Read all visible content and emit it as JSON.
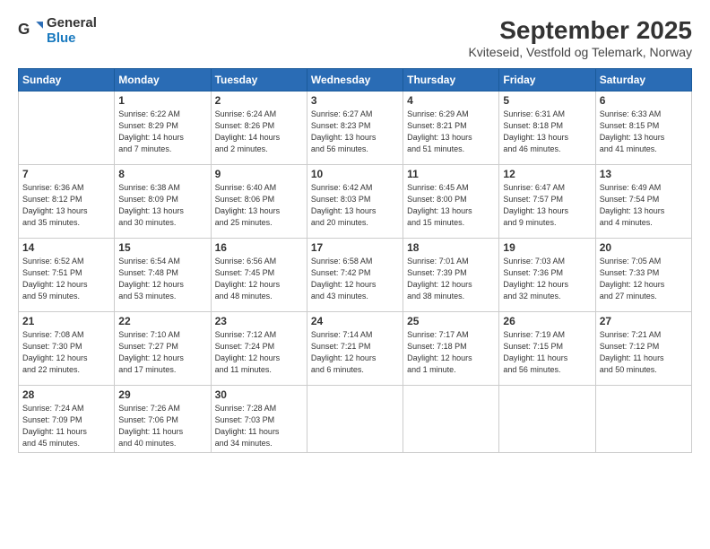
{
  "header": {
    "logo_general": "General",
    "logo_blue": "Blue",
    "month_title": "September 2025",
    "subtitle": "Kviteseid, Vestfold og Telemark, Norway"
  },
  "days_of_week": [
    "Sunday",
    "Monday",
    "Tuesday",
    "Wednesday",
    "Thursday",
    "Friday",
    "Saturday"
  ],
  "weeks": [
    [
      {
        "day": "",
        "info": ""
      },
      {
        "day": "1",
        "info": "Sunrise: 6:22 AM\nSunset: 8:29 PM\nDaylight: 14 hours\nand 7 minutes."
      },
      {
        "day": "2",
        "info": "Sunrise: 6:24 AM\nSunset: 8:26 PM\nDaylight: 14 hours\nand 2 minutes."
      },
      {
        "day": "3",
        "info": "Sunrise: 6:27 AM\nSunset: 8:23 PM\nDaylight: 13 hours\nand 56 minutes."
      },
      {
        "day": "4",
        "info": "Sunrise: 6:29 AM\nSunset: 8:21 PM\nDaylight: 13 hours\nand 51 minutes."
      },
      {
        "day": "5",
        "info": "Sunrise: 6:31 AM\nSunset: 8:18 PM\nDaylight: 13 hours\nand 46 minutes."
      },
      {
        "day": "6",
        "info": "Sunrise: 6:33 AM\nSunset: 8:15 PM\nDaylight: 13 hours\nand 41 minutes."
      }
    ],
    [
      {
        "day": "7",
        "info": "Sunrise: 6:36 AM\nSunset: 8:12 PM\nDaylight: 13 hours\nand 35 minutes."
      },
      {
        "day": "8",
        "info": "Sunrise: 6:38 AM\nSunset: 8:09 PM\nDaylight: 13 hours\nand 30 minutes."
      },
      {
        "day": "9",
        "info": "Sunrise: 6:40 AM\nSunset: 8:06 PM\nDaylight: 13 hours\nand 25 minutes."
      },
      {
        "day": "10",
        "info": "Sunrise: 6:42 AM\nSunset: 8:03 PM\nDaylight: 13 hours\nand 20 minutes."
      },
      {
        "day": "11",
        "info": "Sunrise: 6:45 AM\nSunset: 8:00 PM\nDaylight: 13 hours\nand 15 minutes."
      },
      {
        "day": "12",
        "info": "Sunrise: 6:47 AM\nSunset: 7:57 PM\nDaylight: 13 hours\nand 9 minutes."
      },
      {
        "day": "13",
        "info": "Sunrise: 6:49 AM\nSunset: 7:54 PM\nDaylight: 13 hours\nand 4 minutes."
      }
    ],
    [
      {
        "day": "14",
        "info": "Sunrise: 6:52 AM\nSunset: 7:51 PM\nDaylight: 12 hours\nand 59 minutes."
      },
      {
        "day": "15",
        "info": "Sunrise: 6:54 AM\nSunset: 7:48 PM\nDaylight: 12 hours\nand 53 minutes."
      },
      {
        "day": "16",
        "info": "Sunrise: 6:56 AM\nSunset: 7:45 PM\nDaylight: 12 hours\nand 48 minutes."
      },
      {
        "day": "17",
        "info": "Sunrise: 6:58 AM\nSunset: 7:42 PM\nDaylight: 12 hours\nand 43 minutes."
      },
      {
        "day": "18",
        "info": "Sunrise: 7:01 AM\nSunset: 7:39 PM\nDaylight: 12 hours\nand 38 minutes."
      },
      {
        "day": "19",
        "info": "Sunrise: 7:03 AM\nSunset: 7:36 PM\nDaylight: 12 hours\nand 32 minutes."
      },
      {
        "day": "20",
        "info": "Sunrise: 7:05 AM\nSunset: 7:33 PM\nDaylight: 12 hours\nand 27 minutes."
      }
    ],
    [
      {
        "day": "21",
        "info": "Sunrise: 7:08 AM\nSunset: 7:30 PM\nDaylight: 12 hours\nand 22 minutes."
      },
      {
        "day": "22",
        "info": "Sunrise: 7:10 AM\nSunset: 7:27 PM\nDaylight: 12 hours\nand 17 minutes."
      },
      {
        "day": "23",
        "info": "Sunrise: 7:12 AM\nSunset: 7:24 PM\nDaylight: 12 hours\nand 11 minutes."
      },
      {
        "day": "24",
        "info": "Sunrise: 7:14 AM\nSunset: 7:21 PM\nDaylight: 12 hours\nand 6 minutes."
      },
      {
        "day": "25",
        "info": "Sunrise: 7:17 AM\nSunset: 7:18 PM\nDaylight: 12 hours\nand 1 minute."
      },
      {
        "day": "26",
        "info": "Sunrise: 7:19 AM\nSunset: 7:15 PM\nDaylight: 11 hours\nand 56 minutes."
      },
      {
        "day": "27",
        "info": "Sunrise: 7:21 AM\nSunset: 7:12 PM\nDaylight: 11 hours\nand 50 minutes."
      }
    ],
    [
      {
        "day": "28",
        "info": "Sunrise: 7:24 AM\nSunset: 7:09 PM\nDaylight: 11 hours\nand 45 minutes."
      },
      {
        "day": "29",
        "info": "Sunrise: 7:26 AM\nSunset: 7:06 PM\nDaylight: 11 hours\nand 40 minutes."
      },
      {
        "day": "30",
        "info": "Sunrise: 7:28 AM\nSunset: 7:03 PM\nDaylight: 11 hours\nand 34 minutes."
      },
      {
        "day": "",
        "info": ""
      },
      {
        "day": "",
        "info": ""
      },
      {
        "day": "",
        "info": ""
      },
      {
        "day": "",
        "info": ""
      }
    ]
  ]
}
